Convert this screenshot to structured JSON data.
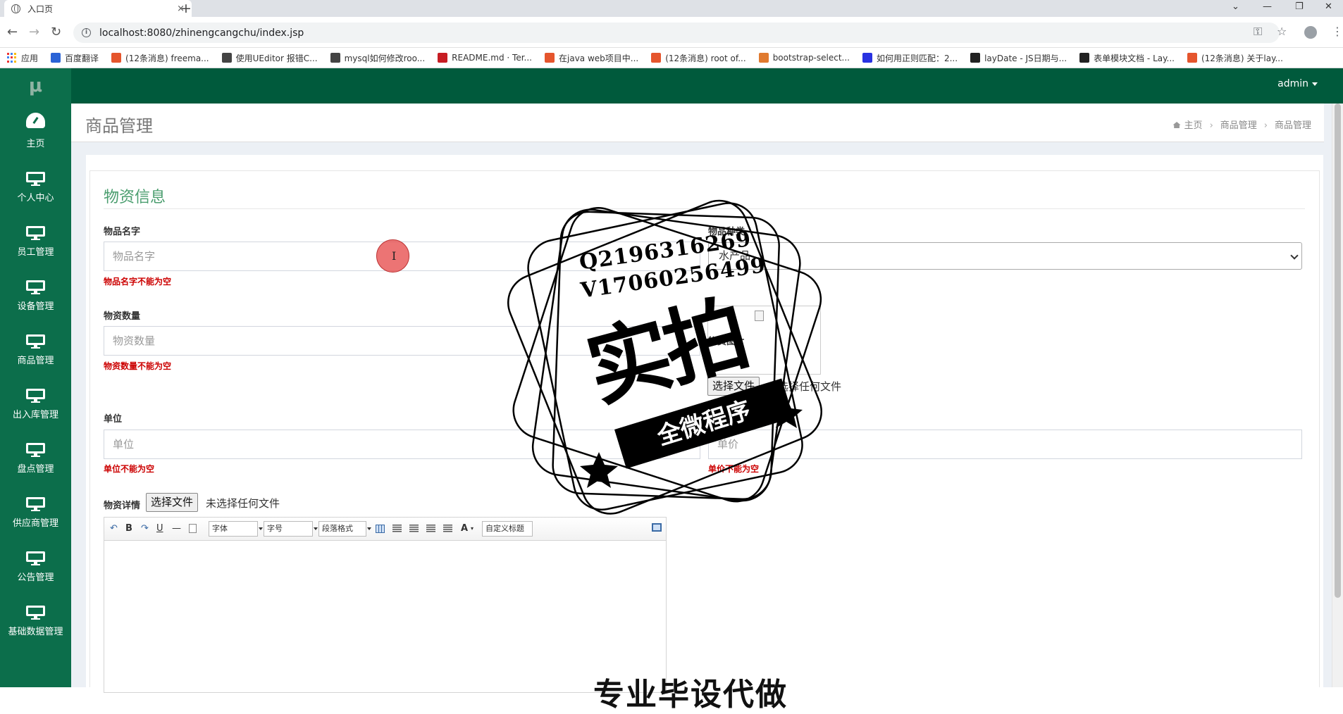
{
  "browser": {
    "tab_title": "入口页",
    "tab_close": "×",
    "new_tab": "+",
    "url": "localhost:8080/zhinengcangchu/index.jsp",
    "bookmarks": [
      {
        "label": "应用",
        "icon": "apps-icon",
        "color": "#e33"
      },
      {
        "label": "百度翻译",
        "icon": "translate-icon",
        "color": "#2a63d6"
      },
      {
        "label": "(12条消息) freema...",
        "icon": "csdn-icon",
        "color": "#e5552d"
      },
      {
        "label": "使用UEditor 报错C...",
        "icon": "yuque-icon",
        "color": "#444"
      },
      {
        "label": "mysql如何修改roo...",
        "icon": "yuque-icon",
        "color": "#444"
      },
      {
        "label": "README.md · Ter...",
        "icon": "gitee-icon",
        "color": "#c71d23"
      },
      {
        "label": "在java web项目中...",
        "icon": "csdn-icon",
        "color": "#e5552d"
      },
      {
        "label": "(12条消息) root of...",
        "icon": "csdn-icon",
        "color": "#e5552d"
      },
      {
        "label": "bootstrap-select...",
        "icon": "cnblogs-icon",
        "color": "#e07a2f"
      },
      {
        "label": "如何用正则匹配：2...",
        "icon": "baidu-icon",
        "color": "#2932e1"
      },
      {
        "label": "layDate - JS日期与...",
        "icon": "layui-icon",
        "color": "#222"
      },
      {
        "label": "表单模块文档 - Lay...",
        "icon": "layui-icon",
        "color": "#222"
      },
      {
        "label": "(12条消息) 关于lay...",
        "icon": "csdn-icon",
        "color": "#e5552d"
      }
    ]
  },
  "app": {
    "logo": "μ",
    "user": "admin",
    "accent": "#005a3c",
    "sidebar_color": "#0c6e4b"
  },
  "sidebar": [
    {
      "label": "主页",
      "icon": "dashboard-icon"
    },
    {
      "label": "个人中心",
      "icon": "monitor-icon"
    },
    {
      "label": "员工管理",
      "icon": "monitor-icon"
    },
    {
      "label": "设备管理",
      "icon": "monitor-icon"
    },
    {
      "label": "商品管理",
      "icon": "monitor-icon"
    },
    {
      "label": "出入库管理",
      "icon": "monitor-icon"
    },
    {
      "label": "盘点管理",
      "icon": "monitor-icon"
    },
    {
      "label": "供应商管理",
      "icon": "monitor-icon"
    },
    {
      "label": "公告管理",
      "icon": "monitor-icon"
    },
    {
      "label": "基础数据管理",
      "icon": "monitor-icon"
    }
  ],
  "page": {
    "title": "商品管理",
    "breadcrumb": [
      "主页",
      "商品管理",
      "商品管理"
    ],
    "breadcrumb_sep": "›"
  },
  "form": {
    "section_title": "物资信息",
    "name_label": "物品名字",
    "name_placeholder": "物品名字",
    "name_error": "物品名字不能为空",
    "type_label": "物品种类",
    "type_value": "水产品",
    "qty_label": "物资数量",
    "qty_placeholder": "物资数量",
    "qty_error": "物资数量不能为空",
    "photo_label": "物资图片",
    "photo_button": "选择文件",
    "photo_note": "未选择任何文件",
    "unit_label": "单位",
    "unit_placeholder": "单位",
    "unit_error": "单位不能为空",
    "price_placeholder": "单价",
    "price_error": "单价不能为空",
    "detail_label": "物资详情",
    "detail_button": "选择文件",
    "detail_note": "未选择任何文件"
  },
  "editor": {
    "bold": "B",
    "underline": "U",
    "hr": "—",
    "font_family": "字体",
    "font_size": "字号",
    "paragraph": "段落格式",
    "font_color": "A",
    "custom_title": "自定义标题"
  },
  "watermark": {
    "qq": "Q2196316269",
    "wechat": "V17060256499",
    "main": "实拍",
    "ribbon": "全微程序",
    "bottom": "专业毕设代做"
  }
}
